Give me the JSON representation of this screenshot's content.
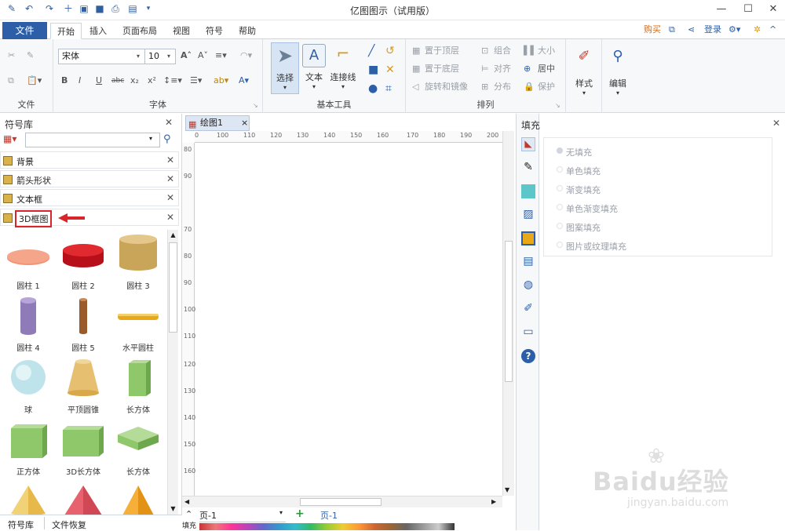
{
  "app_title": "亿图图示（试用版）",
  "menu": {
    "file": "文件",
    "tabs": [
      "开始",
      "插入",
      "页面布局",
      "视图",
      "符号",
      "帮助"
    ],
    "right": {
      "buy": "购买",
      "login": "登录"
    }
  },
  "ribbon": {
    "file_group": {
      "title": "文件"
    },
    "font_group": {
      "title": "字体",
      "font_name": "宋体",
      "font_size": "10"
    },
    "tools_group": {
      "title": "基本工具",
      "select": "选择",
      "text": "文本",
      "connector": "连接线"
    },
    "arrange_group": {
      "title": "排列",
      "bring_front": "置于顶层",
      "send_back": "置于底层",
      "rotate": "旋转和镜像",
      "group": "组合",
      "align": "对齐",
      "distribute": "分布",
      "size": "大小",
      "center": "居中",
      "protect": "保护"
    },
    "style_btn": "样式",
    "edit_btn": "编辑"
  },
  "library": {
    "title": "符号库",
    "search_placeholder": "",
    "categories": [
      "背景",
      "箭头形状",
      "文本框",
      "3D框图"
    ],
    "shapes": [
      "圆柱 1",
      "圆柱 2",
      "圆柱 3",
      "圆柱 4",
      "圆柱 5",
      "水平圆柱",
      "球",
      "平顶圆锥",
      "长方体",
      "正方体",
      "3D长方体",
      "长方体"
    ]
  },
  "canvas": {
    "tab": "绘图1",
    "hruler": [
      "0",
      "100",
      "110",
      "120",
      "130",
      "140",
      "150",
      "160",
      "170",
      "180",
      "190",
      "200"
    ],
    "vruler": [
      "80",
      "90",
      "70",
      "80",
      "90",
      "100",
      "110",
      "120",
      "130",
      "140",
      "150",
      "160"
    ],
    "page_select": "页-1",
    "page_tab": "页-1",
    "fill_label": "填充"
  },
  "fill_panel": {
    "title": "填充",
    "options": [
      "无填充",
      "单色填充",
      "渐变填充",
      "单色渐变填充",
      "图案填充",
      "图片或纹理填充"
    ]
  },
  "bottom_tabs": [
    "符号库",
    "文件恢复"
  ],
  "watermark": {
    "logo": "Baidu经验",
    "url": "jingyan.baidu.com"
  },
  "colors": {
    "accent": "#2c5fa8",
    "annotation": "#d9252a"
  }
}
